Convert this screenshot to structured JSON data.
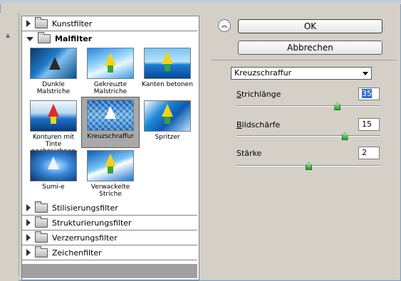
{
  "dialog": {
    "ok_label": "OK",
    "cancel_label": "Abbrechen",
    "collapse_icon": "chevron-double-up-icon"
  },
  "categories": {
    "kunstfilter": "Kunstfilter",
    "malfilter": "Malfilter",
    "stilisierungsfilter": "Stilisierungsfilter",
    "strukturierungsfilter": "Strukturierungsfilter",
    "verzerrungsfilter": "Verzerrungsfilter",
    "zeichenfilter": "Zeichenfilter"
  },
  "thumbnails": [
    {
      "label": "Dunkle Malstriche"
    },
    {
      "label": "Gekreuzte\nMalstriche"
    },
    {
      "label": "Kanten betonen"
    },
    {
      "label": "Konturen mit Tinte\nnachzeichnen"
    },
    {
      "label": "Kreuzschraffur"
    },
    {
      "label": "Spritzer"
    },
    {
      "label": "Sumi-e"
    },
    {
      "label": "Verwackelte\nStriche"
    }
  ],
  "selected_filter": "Kreuzschraffur",
  "settings": {
    "filter_select_value": "Kreuzschraffur",
    "params": [
      {
        "label_key": "S",
        "label_rest": "trichlänge",
        "value": "35",
        "slider": 0.7
      },
      {
        "label_key": "B",
        "label_rest": "ildschärfe",
        "value": "15",
        "slider": 0.75
      },
      {
        "label_key": "",
        "label_rest": "Stärke",
        "value": "2",
        "slider": 0.5
      }
    ]
  },
  "colors": {
    "selection_highlight": "#316ac5",
    "slider_thumb": "#2f9a2f"
  }
}
